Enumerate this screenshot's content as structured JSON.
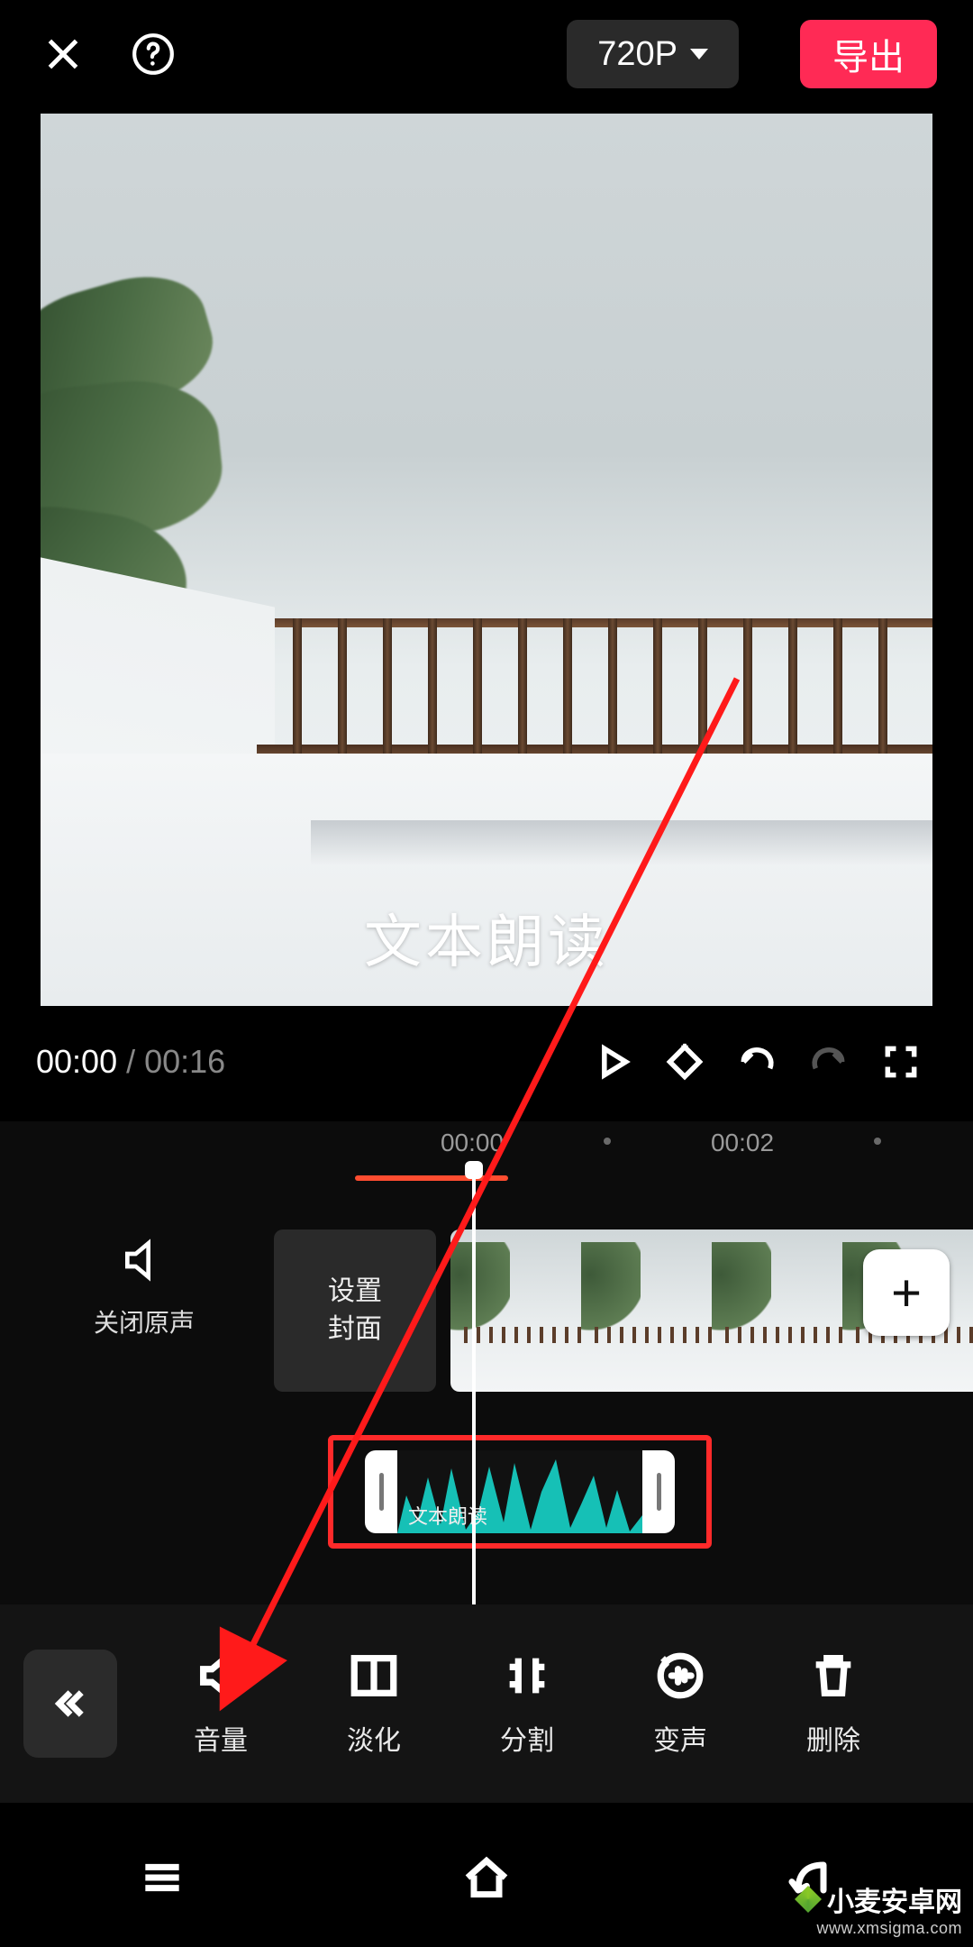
{
  "header": {
    "resolution_label": "720P",
    "export_label": "导出"
  },
  "preview": {
    "overlay_text": "文本朗读"
  },
  "controls": {
    "current_time": "00:00",
    "separator": "/",
    "total_time": "00:16"
  },
  "timeline": {
    "ticks": [
      "00:00",
      "00:02"
    ],
    "mute_label": "关闭原声",
    "cover_line1": "设置",
    "cover_line2": "封面",
    "add_label": "+",
    "audio_clip_label": "文本朗读"
  },
  "toolbar": {
    "items": [
      {
        "id": "volume",
        "label": "音量"
      },
      {
        "id": "fade",
        "label": "淡化"
      },
      {
        "id": "split",
        "label": "分割"
      },
      {
        "id": "voicefx",
        "label": "变声"
      },
      {
        "id": "delete",
        "label": "删除"
      }
    ]
  },
  "watermark": {
    "brand": "小麦安卓网",
    "url": "www.xmsigma.com"
  }
}
